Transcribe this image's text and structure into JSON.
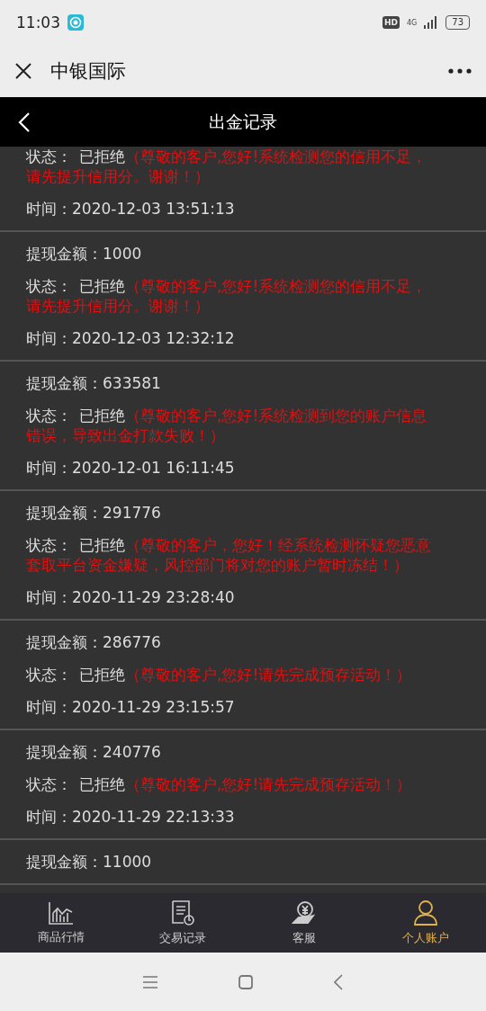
{
  "status_bar": {
    "time": "11:03",
    "hd": "HD",
    "network": "4G",
    "battery": "73"
  },
  "title_bar": {
    "title": "中银国际"
  },
  "header": {
    "title": "出金记录"
  },
  "records": [
    {
      "status_label": "状态：",
      "status": "已拒绝",
      "reason": "（尊敬的客户,您好!系统检测您的信用不足，请先提升信用分。谢谢！）",
      "time": "时间：2020-12-03 13:51:13"
    },
    {
      "amount": "提现金额：1000",
      "status_label": "状态：",
      "status": "已拒绝",
      "reason": "（尊敬的客户,您好!系统检测您的信用不足，请先提升信用分。谢谢！）",
      "time": "时间：2020-12-03 12:32:12"
    },
    {
      "amount": "提现金额：633581",
      "status_label": "状态：",
      "status": "已拒绝",
      "reason": "（尊敬的客户,您好!系统检测到您的账户信息错误，导致出金打款失败！）",
      "time": "时间：2020-12-01 16:11:45"
    },
    {
      "amount": "提现金额：291776",
      "status_label": "状态：",
      "status": "已拒绝",
      "reason": "（尊敬的客户，您好！经系统检测怀疑您恶意套取平台资金嫌疑，风控部门将对您的账户暂时冻结！）",
      "time": "时间：2020-11-29 23:28:40"
    },
    {
      "amount": "提现金额：286776",
      "status_label": "状态：",
      "status": "已拒绝",
      "reason": "（尊敬的客户,您好!请先完成预存活动！）",
      "time": "时间：2020-11-29 23:15:57"
    },
    {
      "amount": "提现金额：240776",
      "status_label": "状态：",
      "status": "已拒绝",
      "reason": "（尊敬的客户,您好!请先完成预存活动！）",
      "time": "时间：2020-11-29 22:13:33"
    },
    {
      "amount": "提现金额：11000"
    }
  ],
  "tabs": [
    {
      "label": "商品行情",
      "kind": "chart",
      "selected": false
    },
    {
      "label": "交易记录",
      "kind": "record",
      "selected": false
    },
    {
      "label": "客服",
      "kind": "service",
      "selected": false
    },
    {
      "label": "个人账户",
      "kind": "user",
      "selected": true
    }
  ]
}
